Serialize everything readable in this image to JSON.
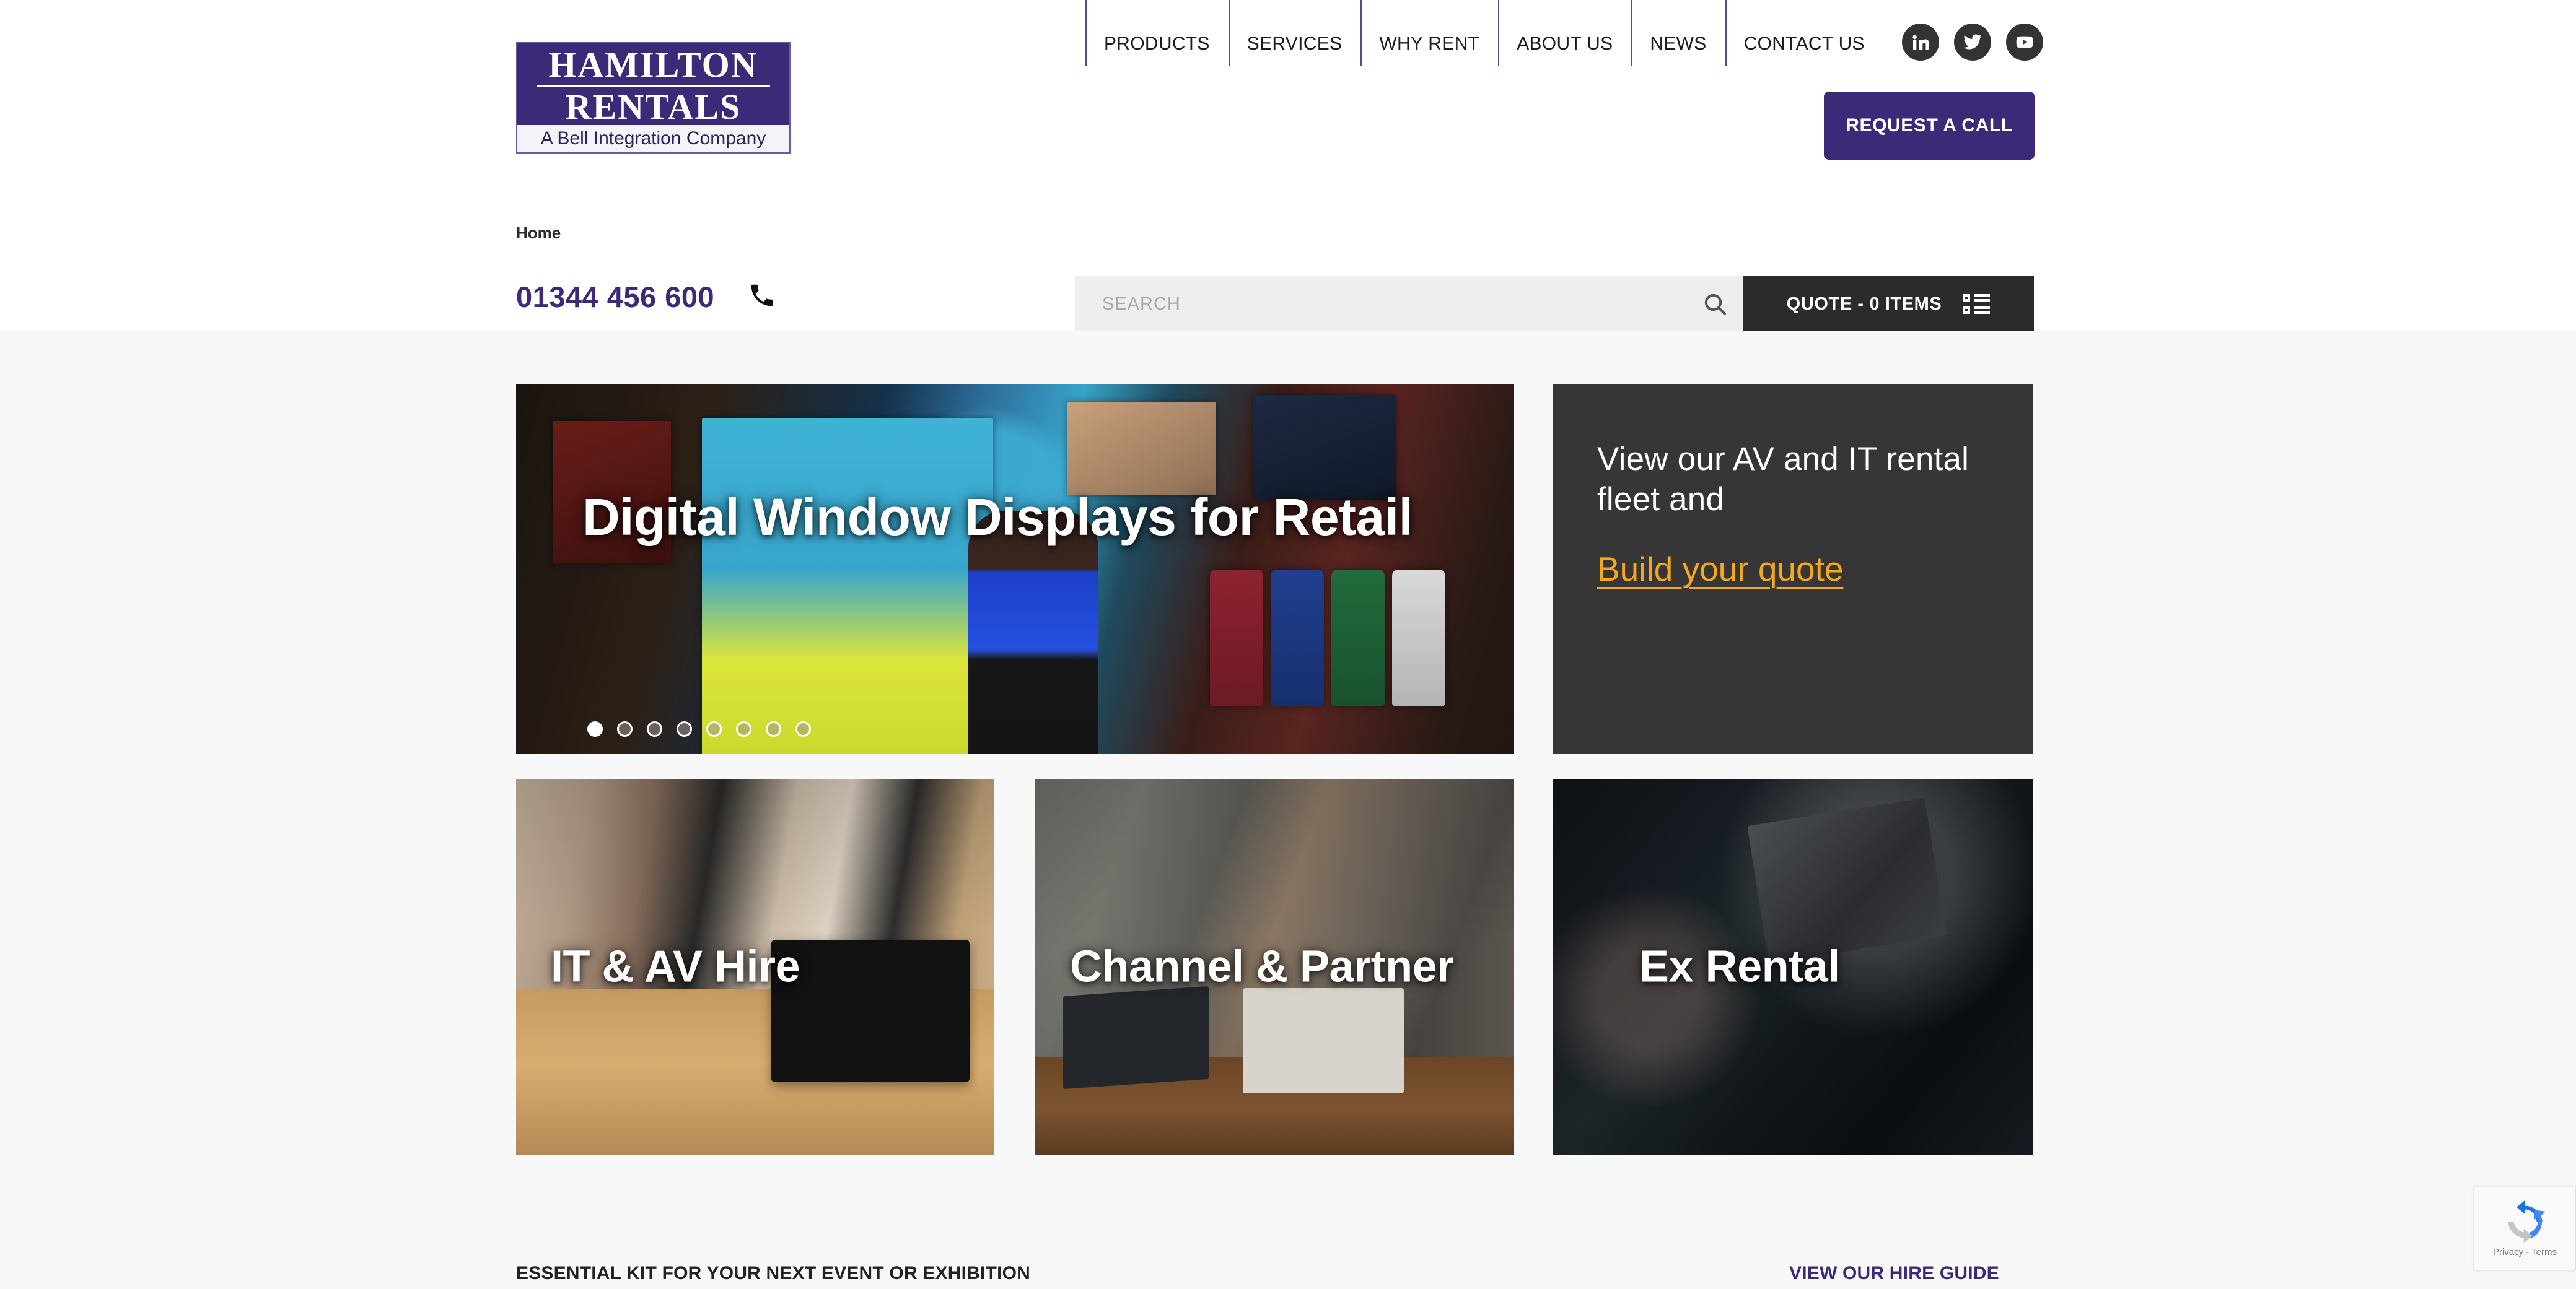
{
  "header": {
    "logo": {
      "line1": "HAMILTON",
      "line2": "RENTALS",
      "tagline": "A Bell Integration Company"
    },
    "nav": [
      {
        "label": "PRODUCTS"
      },
      {
        "label": "SERVICES"
      },
      {
        "label": "WHY RENT"
      },
      {
        "label": "ABOUT US"
      },
      {
        "label": "NEWS"
      },
      {
        "label": "CONTACT US"
      }
    ],
    "socials": [
      {
        "name": "linkedin",
        "label": "LinkedIn"
      },
      {
        "name": "twitter",
        "label": "Twitter"
      },
      {
        "name": "youtube",
        "label": "YouTube"
      }
    ],
    "request_call_label": "REQUEST A CALL",
    "brand_purple": "#3C2A78"
  },
  "breadcrumb": {
    "label": "Home"
  },
  "contact": {
    "phone": "01344 456 600"
  },
  "search": {
    "placeholder": "SEARCH",
    "value": ""
  },
  "quote": {
    "label": "QUOTE - 0 ITEMS",
    "items_count": 0
  },
  "hero": {
    "title": "Digital Window Displays for Retail",
    "slide_count": 8,
    "active_slide": 1
  },
  "promo": {
    "text": "View our AV and IT rental fleet and",
    "link_label": "Build your quote",
    "background": "#363636",
    "link_color": "#F6A81C"
  },
  "cards": [
    {
      "caption": "IT & AV Hire"
    },
    {
      "caption": "Channel & Partner"
    },
    {
      "caption": "Ex Rental"
    }
  ],
  "bottom": {
    "essential_title": "ESSENTIAL KIT FOR YOUR NEXT EVENT OR EXHIBITION",
    "hire_guide_label": "VIEW OUR HIRE GUIDE"
  },
  "recaptcha": {
    "terms": "Privacy - Terms"
  }
}
